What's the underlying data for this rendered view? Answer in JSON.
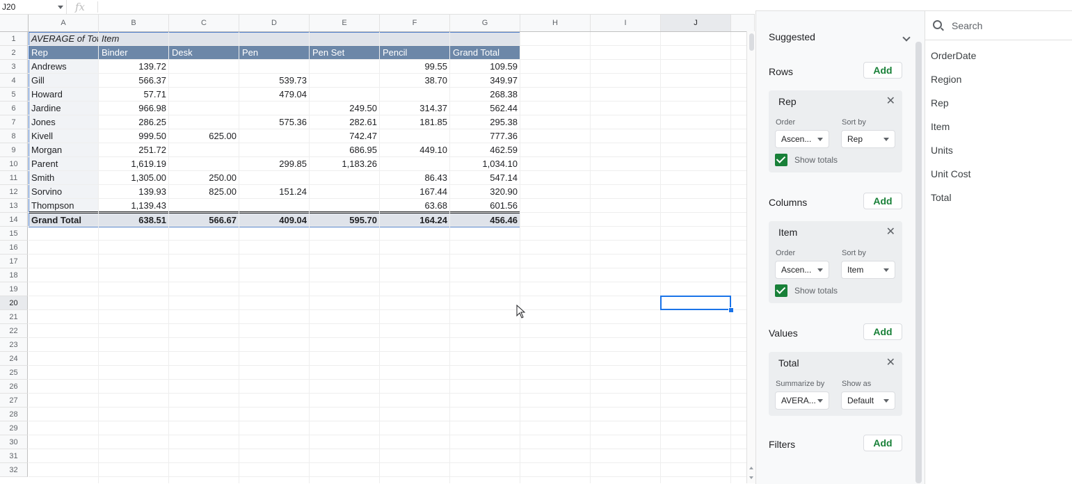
{
  "name_box": "J20",
  "fx_label": "fx",
  "columns": [
    "A",
    "B",
    "C",
    "D",
    "E",
    "F",
    "G",
    "H",
    "I",
    "J"
  ],
  "rows": [
    "1",
    "2",
    "3",
    "4",
    "5",
    "6",
    "7",
    "8",
    "9",
    "10",
    "11",
    "12",
    "13",
    "14",
    "15",
    "16",
    "17",
    "18",
    "19",
    "20",
    "21",
    "22",
    "23",
    "24",
    "25",
    "26",
    "27",
    "28",
    "29",
    "30",
    "31",
    "32"
  ],
  "selected": {
    "column": "J",
    "row": "20"
  },
  "pivot": {
    "title": "AVERAGE of Tota",
    "title_col_label": "Item",
    "row_header": "Rep",
    "col_headers": [
      "Binder",
      "Desk",
      "Pen",
      "Pen Set",
      "Pencil",
      "Grand Total"
    ],
    "rows": [
      {
        "rep": "Andrews",
        "vals": [
          "139.72",
          "",
          "",
          "",
          "99.55",
          "109.59"
        ]
      },
      {
        "rep": "Gill",
        "vals": [
          "566.37",
          "",
          "539.73",
          "",
          "38.70",
          "349.97"
        ]
      },
      {
        "rep": "Howard",
        "vals": [
          "57.71",
          "",
          "479.04",
          "",
          "",
          "268.38"
        ]
      },
      {
        "rep": "Jardine",
        "vals": [
          "966.98",
          "",
          "",
          "249.50",
          "314.37",
          "562.44"
        ]
      },
      {
        "rep": "Jones",
        "vals": [
          "286.25",
          "",
          "575.36",
          "282.61",
          "181.85",
          "295.38"
        ]
      },
      {
        "rep": "Kivell",
        "vals": [
          "999.50",
          "625.00",
          "",
          "742.47",
          "",
          "777.36"
        ]
      },
      {
        "rep": "Morgan",
        "vals": [
          "251.72",
          "",
          "",
          "686.95",
          "449.10",
          "462.59"
        ]
      },
      {
        "rep": "Parent",
        "vals": [
          "1,619.19",
          "",
          "299.85",
          "1,183.26",
          "",
          "1,034.10"
        ]
      },
      {
        "rep": "Smith",
        "vals": [
          "1,305.00",
          "250.00",
          "",
          "",
          "86.43",
          "547.14"
        ]
      },
      {
        "rep": "Sorvino",
        "vals": [
          "139.93",
          "825.00",
          "151.24",
          "",
          "167.44",
          "320.90"
        ]
      },
      {
        "rep": "Thompson",
        "vals": [
          "1,139.43",
          "",
          "",
          "",
          "63.68",
          "601.56"
        ]
      }
    ],
    "grand_total": {
      "label": "Grand Total",
      "vals": [
        "638.51",
        "566.67",
        "409.04",
        "595.70",
        "164.24",
        "456.46"
      ]
    }
  },
  "editor": {
    "suggested_label": "Suggested",
    "add_label": "Add",
    "rows": {
      "label": "Rows",
      "field": "Rep",
      "order_label": "Order",
      "order_value": "Ascen...",
      "sortby_label": "Sort by",
      "sortby_value": "Rep",
      "show_totals": "Show totals"
    },
    "columns": {
      "label": "Columns",
      "field": "Item",
      "order_label": "Order",
      "order_value": "Ascen...",
      "sortby_label": "Sort by",
      "sortby_value": "Item",
      "show_totals": "Show totals"
    },
    "values": {
      "label": "Values",
      "field": "Total",
      "summarize_label": "Summarize by",
      "summarize_value": "AVERA...",
      "showas_label": "Show as",
      "showas_value": "Default"
    },
    "filters": {
      "label": "Filters"
    }
  },
  "fields_panel": {
    "search_placeholder": "Search",
    "items": [
      "OrderDate",
      "Region",
      "Rep",
      "Item",
      "Units",
      "Unit Cost",
      "Total"
    ]
  },
  "colors": {
    "accent": "#1a73e8",
    "header_blue": "#6c87a8",
    "pivot_light": "#dfe3ea",
    "add_green": "#188038"
  }
}
